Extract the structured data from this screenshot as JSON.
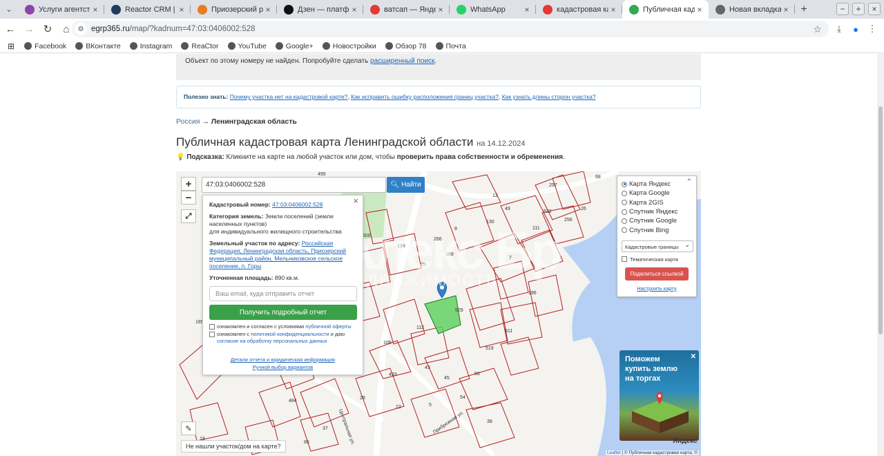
{
  "browser": {
    "tabs": [
      {
        "title": "Услуги агентства",
        "icon": "agency-icon",
        "color": "#8e44ad",
        "active": false
      },
      {
        "title": "Reactor CRM | CRM",
        "icon": "reactor-icon",
        "color": "#1f3b5c",
        "active": false
      },
      {
        "title": "Приозерский район",
        "icon": "puzzle-icon",
        "color": "#e67e22",
        "active": false
      },
      {
        "title": "Дзен — платформа",
        "icon": "dzen-icon",
        "color": "#111111",
        "active": false
      },
      {
        "title": "ватсап — Яндекс",
        "icon": "yandex-icon",
        "color": "#e53935",
        "active": false
      },
      {
        "title": "WhatsApp",
        "icon": "whatsapp-icon",
        "color": "#25d366",
        "active": false
      },
      {
        "title": "кадастровая карта",
        "icon": "yandex-icon",
        "color": "#e53935",
        "active": false
      },
      {
        "title": "Публичная кадастровая",
        "icon": "check-icon",
        "color": "#34a853",
        "active": true
      },
      {
        "title": "Новая вкладка",
        "icon": "globe-icon",
        "color": "#666666",
        "active": false
      }
    ],
    "url_host": "egrp365.ru",
    "url_path": "/map/?kadnum=47:03:0406002:528",
    "bookmarks": [
      {
        "label": "Facebook",
        "icon": "facebook-icon"
      },
      {
        "label": "ВКонтакте",
        "icon": "vk-icon"
      },
      {
        "label": "Instagram",
        "icon": "instagram-icon"
      },
      {
        "label": "ReaCtor",
        "icon": "reactor-icon"
      },
      {
        "label": "YouTube",
        "icon": "youtube-icon"
      },
      {
        "label": "Google+",
        "icon": "google-plus-icon"
      },
      {
        "label": "Новостройки",
        "icon": "building-icon"
      },
      {
        "label": "Обзор 78",
        "icon": "review-icon"
      },
      {
        "label": "Почта",
        "icon": "mail-icon"
      }
    ]
  },
  "page": {
    "notfound_text": "Объект по этому номеру не найден. Попробуйте сделать ",
    "notfound_link": "расширенный поиск",
    "useful_label": "Полезно знать:",
    "useful_links": [
      "Почему участка нет на кадастровой карте?",
      "Как исправить ошибку расположения границ участка?",
      "Как узнать длины сторон участка?"
    ],
    "breadcrumb_root": "Россия",
    "breadcrumb_arrow": "→",
    "breadcrumb_current": "Ленинградская область",
    "title": "Публичная кадастровая карта Ленинградской области",
    "title_date": "на 14.12.2024",
    "hint_label": "Подсказка:",
    "hint_text": " Кликните на карте на любой участок или дом, чтобы ",
    "hint_bold": "проверить права собственности и обременения",
    "hint_end": "."
  },
  "map": {
    "search_value": "47:03:0406002:528",
    "find_label": "Найти",
    "zoom_in": "+",
    "zoom_out": "−",
    "popup": {
      "kadnum_label": "Кадастровый номер:",
      "kadnum_value": "47:03:0406002:528",
      "category_label": "Категория земель:",
      "category_value": "Земли поселений (земли населенных пунктов)",
      "usage": "для индивидуального жилищного строительства",
      "address_label": "Земельный участок по адресу:",
      "address_value": "Российская Федерация, Ленинградская область, Приозерский муниципальный район, Мельниковское сельское поселение, п. Горы",
      "area_label": "Уточненная площадь:",
      "area_value": "890 кв.м.",
      "email_placeholder": "Ваш email, куда отправить отчет",
      "report_button": "Получить подробный отчет",
      "consent1_text": "ознакомлен и согласен с условиями ",
      "consent1_link": "публичной оферты",
      "consent2_text": "ознакомлен с ",
      "consent2_link": "политикой конфиденциальности",
      "consent2_mid": " и даю ",
      "consent2_link2": "согласие на обработку персональных данных",
      "details_link": "Детали отчета и юридическая информация",
      "manual_link": "Ручной выбор вариантов"
    },
    "layers": {
      "options": [
        "Карта Яндекс",
        "Карта Google",
        "Карта 2GIS",
        "Спутник Яндекс",
        "Спутник Google",
        "Спутник Bing"
      ],
      "selected": "Карта Яндекс",
      "select_value": "Кадастровые границы",
      "thematic_label": "Тематическая карта",
      "share_label": "Поделиться ссылкой",
      "config_link": "Настроить карту"
    },
    "ad_text": "Поможем купить землю на торгах",
    "not_found_btn": "Не нашли участок/дом на карте?",
    "attribution_leaflet": "Leaflet",
    "attribution_rest": " | © Публичная кадастровая карта, ©",
    "yandex_logo": "Яндекс",
    "watermark_big": "Алекс Бр",
    "watermark_small": "НЕДВИЖИМОСТЬ",
    "parcel_labels": [
      "495",
      "257",
      "68",
      "12",
      "49",
      "130",
      "522",
      "26",
      "256",
      "500",
      "138",
      "25",
      "8",
      "266",
      "169",
      "7",
      "111",
      "185",
      "196",
      "529",
      "112",
      "109",
      "511",
      "519",
      "493",
      "43",
      "45",
      "56",
      "484",
      "28",
      "22",
      "5",
      "54",
      "37",
      "38",
      "19",
      "85"
    ],
    "street_labels": [
      "Центральная ул.",
      "Прибрежная ул."
    ]
  }
}
